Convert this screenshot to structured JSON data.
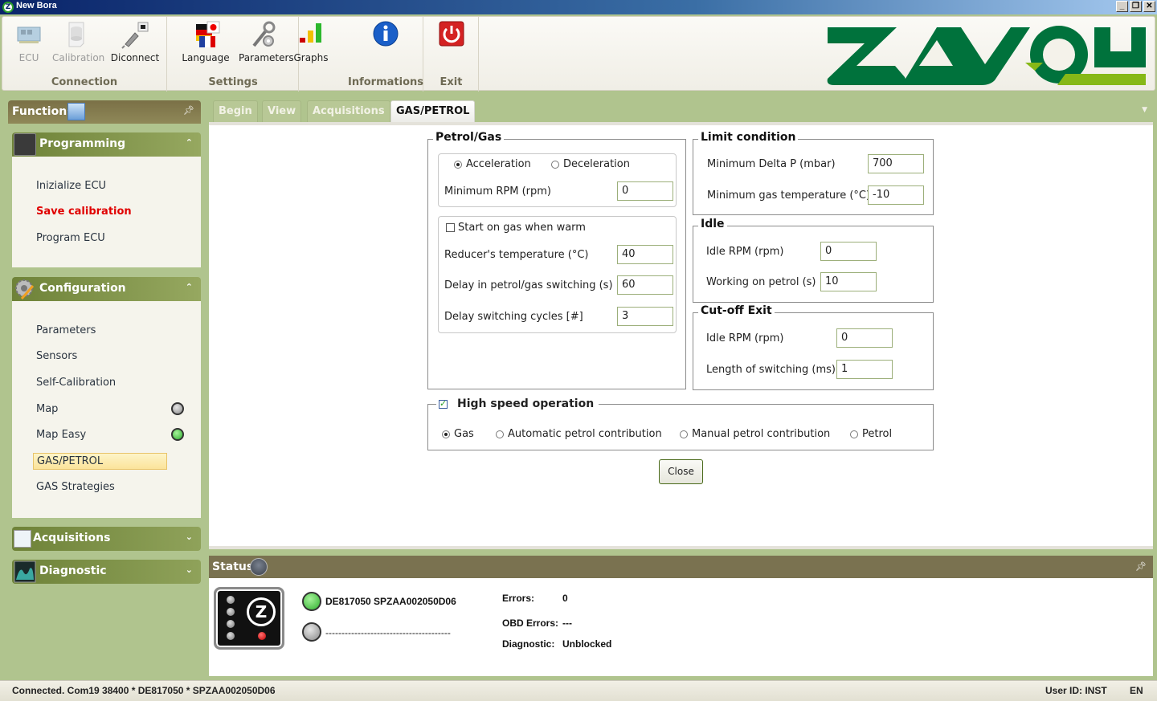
{
  "window": {
    "title": "New Bora",
    "controls": [
      "_",
      "❐",
      "✕"
    ]
  },
  "ribbon": {
    "groups": [
      {
        "label": "Connection",
        "buttons": [
          {
            "label": "ECU",
            "icon": "ecu-board-icon",
            "enabled": false
          },
          {
            "label": "Calibration",
            "icon": "calibration-database-icon",
            "enabled": false
          },
          {
            "label": "Diconnect",
            "icon": "usb-disconnect-icon",
            "enabled": true
          }
        ]
      },
      {
        "label": "Settings",
        "buttons": [
          {
            "label": "Language",
            "icon": "language-flags-icon",
            "enabled": true
          },
          {
            "label": "Parameters",
            "icon": "wrench-gear-icon",
            "enabled": true
          },
          {
            "label": "Graphs",
            "icon": "bar-graph-icon",
            "enabled": true
          }
        ]
      },
      {
        "label": "Informations",
        "buttons": [
          {
            "label": "",
            "icon": "info-icon",
            "enabled": true
          }
        ]
      },
      {
        "label": "Exit",
        "buttons": [
          {
            "label": "",
            "icon": "power-icon",
            "enabled": true
          }
        ]
      }
    ],
    "logo_text": "ZAVOLI"
  },
  "functions": {
    "title": "Functions",
    "sections": [
      {
        "title": "Programming",
        "expanded": true,
        "items": [
          {
            "label": "Inizialize ECU"
          },
          {
            "label": "Save calibration",
            "highlight": "red"
          },
          {
            "label": "Program ECU"
          }
        ]
      },
      {
        "title": "Configuration",
        "expanded": true,
        "items": [
          {
            "label": "Parameters"
          },
          {
            "label": "Sensors"
          },
          {
            "label": "Self-Calibration"
          },
          {
            "label": "Map",
            "status": "gray"
          },
          {
            "label": "Map Easy",
            "status": "green"
          },
          {
            "label": "GAS/PETROL",
            "selected": true
          },
          {
            "label": "GAS Strategies"
          }
        ]
      },
      {
        "title": "Acquisitions",
        "expanded": false
      },
      {
        "title": "Diagnostic",
        "expanded": false
      }
    ]
  },
  "tabs": [
    {
      "label": "Begin",
      "active": false
    },
    {
      "label": "View",
      "active": false
    },
    {
      "label": "Acquisitions",
      "active": false
    },
    {
      "label": "GAS/PETROL",
      "active": true
    }
  ],
  "gas_petrol": {
    "petrol_gas": {
      "title": "Petrol/Gas",
      "mode_options": [
        {
          "label": "Acceleration",
          "checked": true
        },
        {
          "label": "Deceleration",
          "checked": false
        }
      ],
      "min_rpm": {
        "label": "Minimum RPM (rpm)",
        "value": "0"
      },
      "start_on_gas_when_warm": {
        "label": "Start on gas when warm",
        "checked": false
      },
      "reducer_temperature": {
        "label": "Reducer's temperature (°C)",
        "value": "40"
      },
      "delay_switching": {
        "label": "Delay in petrol/gas switching  (s)",
        "value": "60"
      },
      "delay_cycles": {
        "label": "Delay switching cycles [#]",
        "value": "3"
      }
    },
    "limit_condition": {
      "title": "Limit condition",
      "min_delta_p": {
        "label": "Minimum Delta P (mbar)",
        "value": "700"
      },
      "min_gas_temp": {
        "label": "Minimum gas temperature (°C)",
        "value": "-10"
      }
    },
    "idle": {
      "title": "Idle",
      "idle_rpm": {
        "label": "Idle RPM (rpm)",
        "value": "0"
      },
      "working_on_petrol": {
        "label": "Working on petrol (s)",
        "value": "10"
      }
    },
    "cutoff_exit": {
      "title": "Cut-off Exit",
      "idle_rpm": {
        "label": "Idle RPM (rpm)",
        "value": "0"
      },
      "length_switching": {
        "label": "Length of switching (ms)",
        "value": "1"
      }
    },
    "high_speed": {
      "title": "High speed operation",
      "enabled": true,
      "options": [
        {
          "label": "Gas",
          "checked": true
        },
        {
          "label": "Automatic petrol contribution",
          "checked": false
        },
        {
          "label": "Manual petrol contribution",
          "checked": false
        },
        {
          "label": "Petrol",
          "checked": false
        }
      ]
    },
    "close_label": "Close"
  },
  "status": {
    "title": "Status",
    "device_line_1": {
      "text": "DE817050 SPZAA002050D06",
      "led": "green"
    },
    "device_line_2": {
      "text": "---------------------------------------",
      "led": "gray"
    },
    "errors_label": "Errors:",
    "errors_value": "0",
    "obd_errors_label": "OBD Errors:",
    "obd_errors_value": "---",
    "diagnostic_label": "Diagnostic:",
    "diagnostic_value": "Unblocked"
  },
  "statusbar": {
    "connection": "Connected. Com19 38400 * DE817050 * SPZAA002050D06",
    "user": "User ID: INST",
    "language": "EN"
  },
  "colors": {
    "accent_green": "#00723c",
    "lime": "#86b817",
    "panel_header": "#7a7250",
    "section_header": "#6e8238",
    "save_red": "#e00000"
  }
}
